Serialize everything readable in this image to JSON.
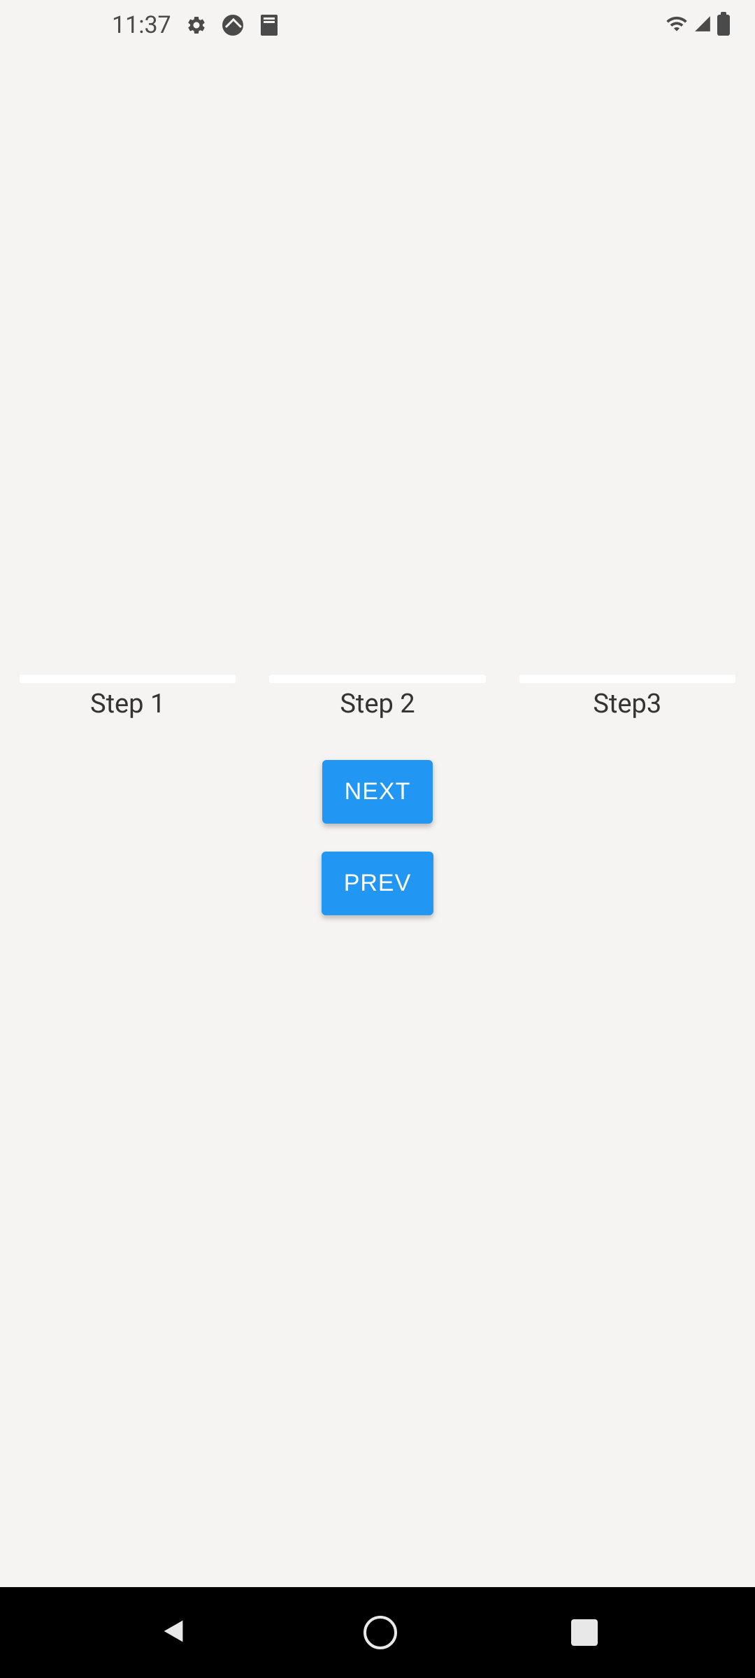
{
  "status_bar": {
    "time": "11:37"
  },
  "stepper": {
    "steps": [
      {
        "label": "Step 1"
      },
      {
        "label": "Step 2"
      },
      {
        "label": "Step3"
      }
    ]
  },
  "buttons": {
    "next_label": "NEXT",
    "prev_label": "PREV"
  },
  "colors": {
    "primary": "#2196f3",
    "background": "#f5f4f2"
  }
}
